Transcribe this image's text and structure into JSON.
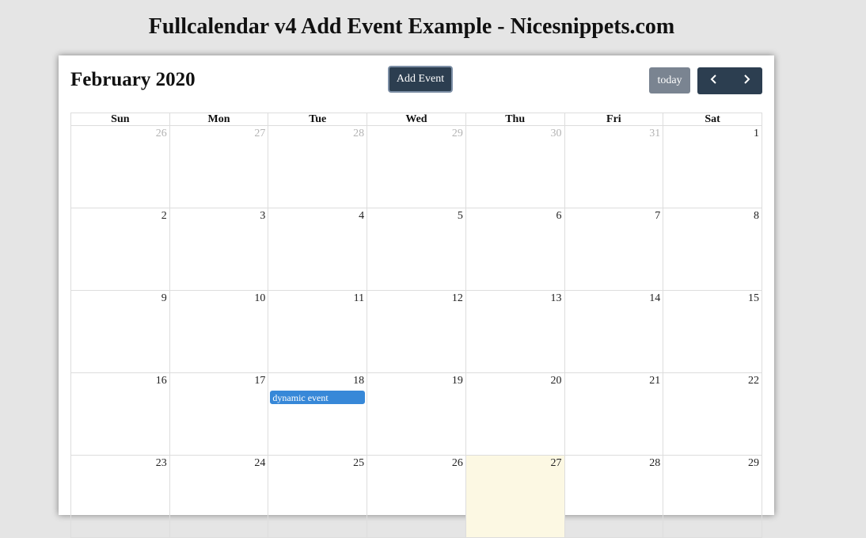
{
  "page": {
    "heading": "Fullcalendar v4 Add Event Example - Nicesnippets.com"
  },
  "calendar": {
    "title": "February 2020",
    "add_event_label": "Add Event",
    "today_label": "today",
    "prev_icon": "chevron-left-icon",
    "next_icon": "chevron-right-icon",
    "day_headers": [
      "Sun",
      "Mon",
      "Tue",
      "Wed",
      "Thu",
      "Fri",
      "Sat"
    ],
    "weeks": [
      [
        {
          "day": "26",
          "other": true
        },
        {
          "day": "27",
          "other": true
        },
        {
          "day": "28",
          "other": true
        },
        {
          "day": "29",
          "other": true
        },
        {
          "day": "30",
          "other": true
        },
        {
          "day": "31",
          "other": true
        },
        {
          "day": "1"
        }
      ],
      [
        {
          "day": "2"
        },
        {
          "day": "3"
        },
        {
          "day": "4"
        },
        {
          "day": "5"
        },
        {
          "day": "6"
        },
        {
          "day": "7"
        },
        {
          "day": "8"
        }
      ],
      [
        {
          "day": "9"
        },
        {
          "day": "10"
        },
        {
          "day": "11"
        },
        {
          "day": "12"
        },
        {
          "day": "13"
        },
        {
          "day": "14"
        },
        {
          "day": "15"
        }
      ],
      [
        {
          "day": "16"
        },
        {
          "day": "17"
        },
        {
          "day": "18",
          "events": [
            "dynamic event"
          ]
        },
        {
          "day": "19"
        },
        {
          "day": "20"
        },
        {
          "day": "21"
        },
        {
          "day": "22"
        }
      ],
      [
        {
          "day": "23"
        },
        {
          "day": "24"
        },
        {
          "day": "25"
        },
        {
          "day": "26"
        },
        {
          "day": "27",
          "today": true
        },
        {
          "day": "28"
        },
        {
          "day": "29"
        }
      ]
    ]
  },
  "colors": {
    "primary": "#2c3e50",
    "event": "#3788d8",
    "today_bg": "#fcf8e3",
    "today_button": "#7a8491"
  }
}
